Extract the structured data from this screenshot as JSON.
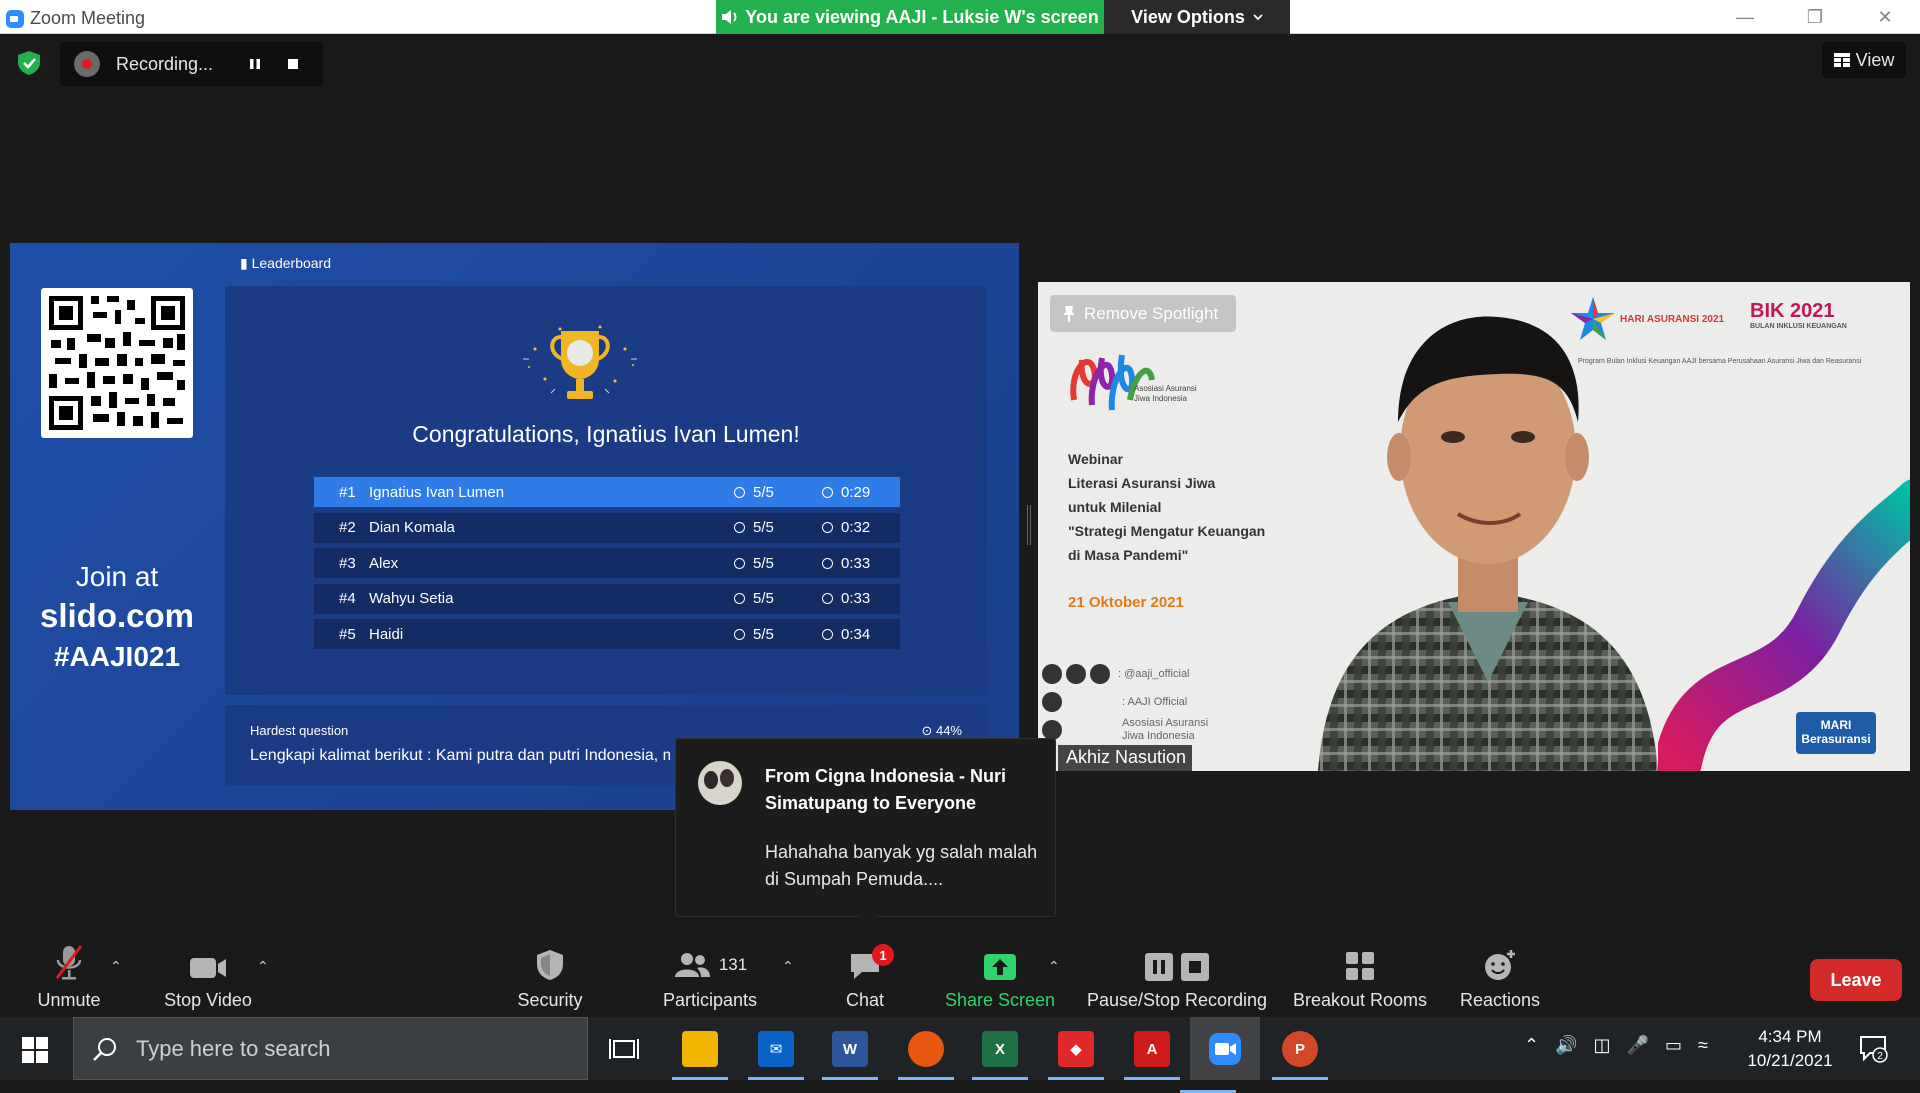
{
  "window": {
    "title": "Zoom Meeting",
    "viewing_banner": "You are viewing AAJI - Luksie W's screen",
    "view_options": "View Options"
  },
  "topbar": {
    "recording_label": "Recording...",
    "view_label": "View"
  },
  "slide": {
    "leaderboard_label": "Leaderboard",
    "join_at": "Join at",
    "join_site": "slido.com",
    "join_code": "#AAJI021",
    "congrats": "Congratulations, Ignatius Ivan Lumen!",
    "rows": [
      {
        "rank": "#1",
        "name": "Ignatius Ivan Lumen",
        "score": "5/5",
        "time": "0:29"
      },
      {
        "rank": "#2",
        "name": "Dian Komala",
        "score": "5/5",
        "time": "0:32"
      },
      {
        "rank": "#3",
        "name": "Alex",
        "score": "5/5",
        "time": "0:33"
      },
      {
        "rank": "#4",
        "name": "Wahyu Setia",
        "score": "5/5",
        "time": "0:33"
      },
      {
        "rank": "#5",
        "name": "Haidi",
        "score": "5/5",
        "time": "0:34"
      }
    ],
    "hardest_label": "Hardest question",
    "hardest_pct": "44%",
    "hardest_question": "Lengkapi kalimat berikut : Kami putra dan putri Indonesia, m"
  },
  "video": {
    "spotlight_label": "Remove Spotlight",
    "aaji_sub": "Asosiasi Asuransi Jiwa Indonesia",
    "webinar_lines": [
      "Webinar",
      "Literasi Asuransi Jiwa",
      "untuk Milenial",
      "\"Strategi Mengatur Keuangan",
      "di Masa Pandemi\""
    ],
    "webinar_date": "21 Oktober 2021",
    "social_handle": ": @aaji_official",
    "youtube": ": AAJI Official",
    "linkedin_1": "Asosiasi Asuransi",
    "linkedin_2": "Jiwa Indonesia",
    "hari_asuransi": "HARI ASURANSI 2021",
    "bik": "BIK 2021",
    "bik_sub": "BULAN INKLUSI KEUANGAN",
    "program_text": "Program Bulan Inklusi Keuangan AAJI bersama Perusahaan Asuransi Jiwa dan Reasuransi",
    "mari": "MARI Berasuransi",
    "speaker_name": "Akhiz Nasution"
  },
  "chat_toast": {
    "from": "From Cigna Indonesia - Nuri Simatupang to Everyone",
    "message": "Hahahaha banyak yg salah malah di Sumpah Pemuda...."
  },
  "toolbar": {
    "unmute": "Unmute",
    "stop_video": "Stop Video",
    "security": "Security",
    "participants": "Participants",
    "participants_count": "131",
    "chat": "Chat",
    "chat_badge": "1",
    "share_screen": "Share Screen",
    "pause_stop_recording": "Pause/Stop Recording",
    "breakout_rooms": "Breakout Rooms",
    "reactions": "Reactions",
    "leave": "Leave"
  },
  "taskbar": {
    "search_placeholder": "Type here to search",
    "time": "4:34 PM",
    "date": "10/21/2021",
    "notifications": "2"
  },
  "colors": {
    "zoom_blue": "#2d8cff",
    "banner_green": "#23b14d",
    "share_green": "#2fd56c",
    "leave_red": "#d42a2a",
    "slide_blue": "#1e4fa8"
  }
}
